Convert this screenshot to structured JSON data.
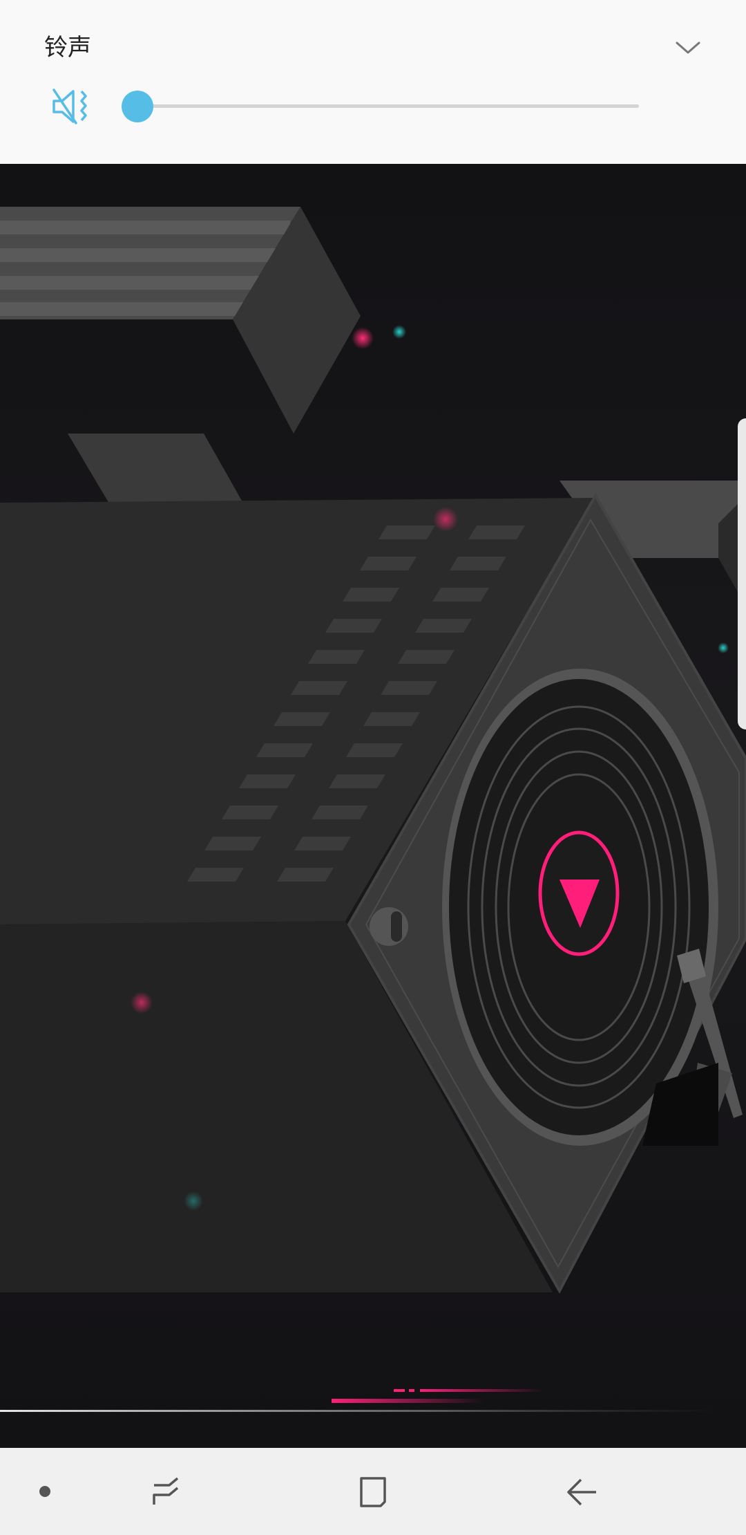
{
  "volume_panel": {
    "title": "铃声",
    "level": 0,
    "accent_color": "#56bde6",
    "mute_icon": "mute-speaker-icon",
    "collapse_icon": "chevron-down-icon"
  },
  "nav_bar": {
    "buttons": [
      {
        "name": "dot-indicator",
        "icon": "dot-icon"
      },
      {
        "name": "recent-apps",
        "icon": "recent-apps-icon"
      },
      {
        "name": "home",
        "icon": "home-icon"
      },
      {
        "name": "back",
        "icon": "back-arrow-icon"
      }
    ]
  },
  "wallpaper": {
    "accent_color": "#ff1f7a"
  }
}
